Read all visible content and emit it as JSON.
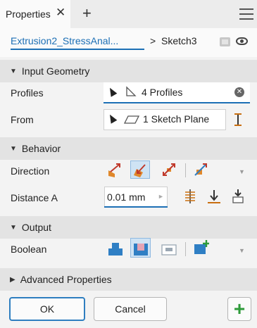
{
  "tab": {
    "title": "Properties",
    "close": "✕",
    "add": "+"
  },
  "breadcrumb": {
    "parent": "Extrusion2_StressAnal...",
    "separator": ">",
    "current": "Sketch3"
  },
  "sections": {
    "input_geometry": "Input Geometry",
    "behavior": "Behavior",
    "output": "Output",
    "advanced": "Advanced Properties"
  },
  "fields": {
    "profiles": {
      "label": "Profiles",
      "value": "4 Profiles"
    },
    "from": {
      "label": "From",
      "value": "1 Sketch Plane"
    },
    "direction": {
      "label": "Direction"
    },
    "distance_a": {
      "label": "Distance A",
      "value": "0.01 mm"
    },
    "boolean": {
      "label": "Boolean"
    }
  },
  "buttons": {
    "ok": "OK",
    "cancel": "Cancel",
    "add": "+"
  },
  "colors": {
    "accent": "#1c6fb5",
    "direction_orange": "#e0872a",
    "boolean_blue": "#2f7fc4",
    "apply_green": "#2e9b3a"
  }
}
